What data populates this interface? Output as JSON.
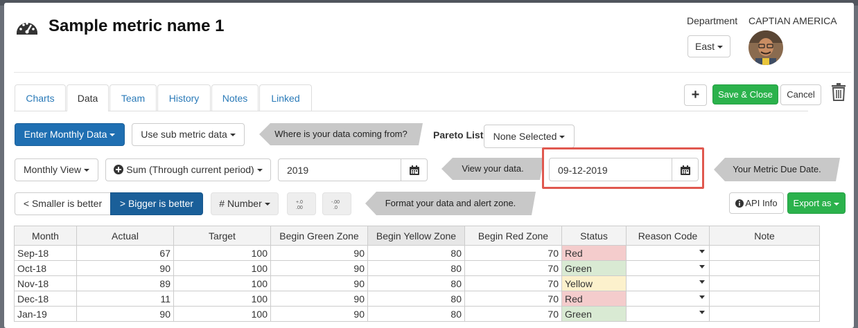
{
  "header": {
    "title": "Sample metric name 1",
    "department_label": "Department",
    "department_value": "East",
    "user_name": "CAPTIAN AMERICA"
  },
  "tabs": [
    {
      "label": "Charts"
    },
    {
      "label": "Data",
      "active": true
    },
    {
      "label": "Team"
    },
    {
      "label": "History"
    },
    {
      "label": "Notes"
    },
    {
      "label": "Linked"
    }
  ],
  "toolbar": {
    "add_label": "+",
    "save_close_label": "Save & Close",
    "cancel_label": "Cancel"
  },
  "row1": {
    "enter_monthly_label": "Enter Monthly Data",
    "sub_metric_label": "Use sub metric data",
    "hint_source": "Where is your data coming from?",
    "pareto_label": "Pareto List",
    "pareto_value": "None Selected"
  },
  "row2": {
    "view_label": "Monthly View",
    "sum_label": "Sum (Through current period)",
    "year_value": "2019",
    "hint_view": "View your data.",
    "due_date_value": "09-12-2019",
    "hint_due": "Your Metric Due Date."
  },
  "row3": {
    "smaller_label": "< Smaller is better",
    "bigger_label": "> Bigger is better",
    "number_label": "# Number",
    "dec_add_label": "+.0 .00",
    "dec_remove_label": "-.00 .0",
    "hint_format": "Format your data and alert zone.",
    "api_info_label": "API Info",
    "export_label": "Export as"
  },
  "table": {
    "columns": [
      "Month",
      "Actual",
      "Target",
      "Begin Green Zone",
      "Begin Yellow Zone",
      "Begin Red Zone",
      "Status",
      "Reason Code",
      "Note"
    ],
    "rows": [
      {
        "month": "Sep-18",
        "actual": "67",
        "target": "100",
        "green": "90",
        "yellow": "80",
        "red": "70",
        "status": "Red",
        "reason": "",
        "note": ""
      },
      {
        "month": "Oct-18",
        "actual": "90",
        "target": "100",
        "green": "90",
        "yellow": "80",
        "red": "70",
        "status": "Green",
        "reason": "",
        "note": ""
      },
      {
        "month": "Nov-18",
        "actual": "89",
        "target": "100",
        "green": "90",
        "yellow": "80",
        "red": "70",
        "status": "Yellow",
        "reason": "",
        "note": ""
      },
      {
        "month": "Dec-18",
        "actual": "11",
        "target": "100",
        "green": "90",
        "yellow": "80",
        "red": "70",
        "status": "Red",
        "reason": "",
        "note": ""
      },
      {
        "month": "Jan-19",
        "actual": "90",
        "target": "100",
        "green": "90",
        "yellow": "80",
        "red": "70",
        "status": "Green",
        "reason": "",
        "note": ""
      }
    ]
  },
  "icons": {
    "title": "dashboard-gauge-icon",
    "trash": "trash-icon",
    "calendar": "calendar-icon",
    "plus_circle": "plus-circle-icon",
    "info": "info-circle-icon"
  },
  "colors": {
    "primary": "#1f6fb2",
    "success": "#2bb24c",
    "highlight": "#e0584f",
    "status_red": "#f4cccc",
    "status_green": "#d9ead3",
    "status_yellow": "#fcf1cc"
  }
}
